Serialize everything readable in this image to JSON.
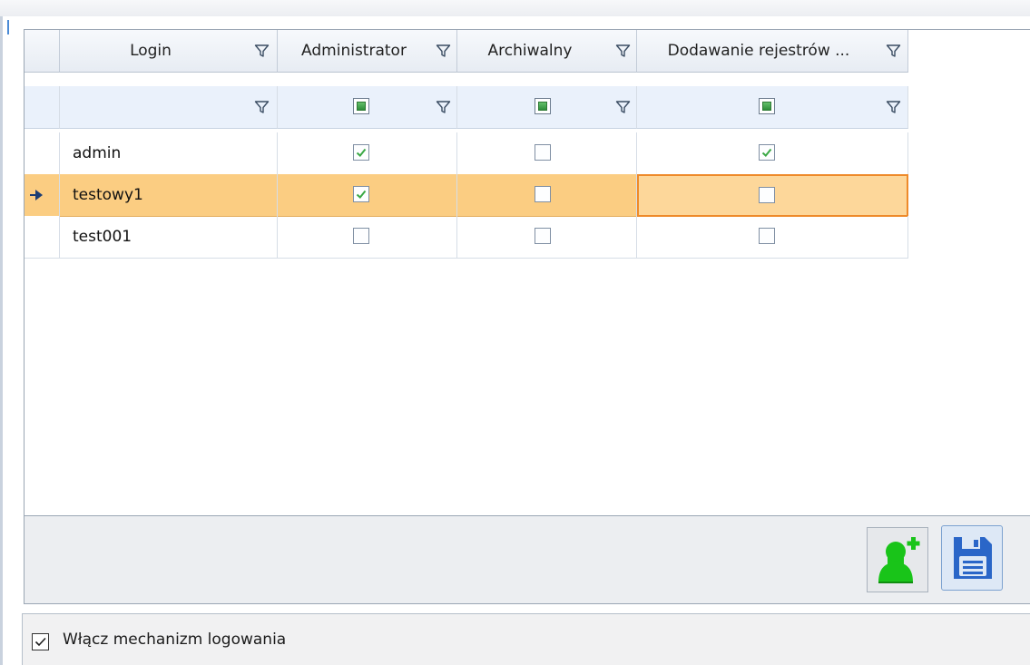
{
  "grid": {
    "columns": [
      {
        "label": "Login"
      },
      {
        "label": "Administrator"
      },
      {
        "label": "Archiwalny"
      },
      {
        "label": "Dodawanie rejestrów ..."
      }
    ],
    "rows": [
      {
        "login": "admin",
        "administrator": true,
        "archiwalny": false,
        "dodawanie": true,
        "selected": false
      },
      {
        "login": "testowy1",
        "administrator": true,
        "archiwalny": false,
        "dodawanie": false,
        "selected": true
      },
      {
        "login": "test001",
        "administrator": false,
        "archiwalny": false,
        "dodawanie": false,
        "selected": false
      }
    ]
  },
  "toolbar": {
    "add_user_icon": "add-user-icon",
    "save_icon": "save-disk-icon"
  },
  "login_mechanism": {
    "label": "Włącz mechanizm logowania",
    "checked": true
  },
  "colors": {
    "selection": "#fbcd82",
    "focus_border": "#ee8a2a",
    "check_green": "#3aa845",
    "add_user_green": "#22cc22",
    "save_blue": "#2a66c8"
  }
}
